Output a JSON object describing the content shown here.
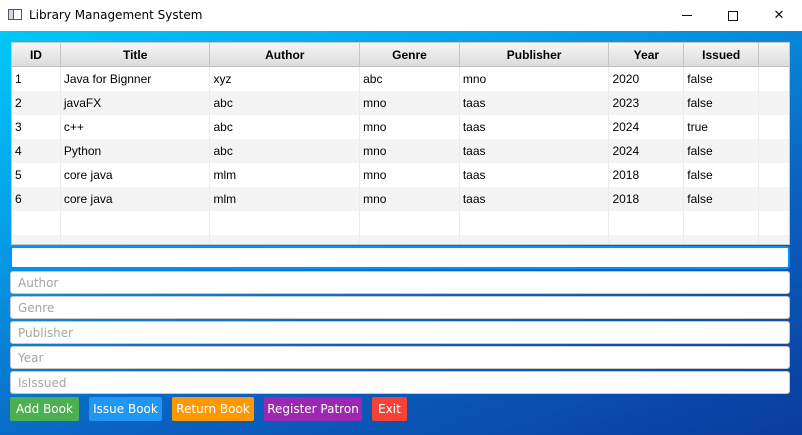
{
  "window": {
    "title": "Library Management System"
  },
  "table": {
    "columns": [
      "ID",
      "Title",
      "Author",
      "Genre",
      "Publisher",
      "Year",
      "Issued"
    ],
    "rows": [
      [
        "1",
        "Java for Bignner",
        "xyz",
        "abc",
        "mno",
        "2020",
        "false"
      ],
      [
        "2",
        "javaFX",
        "abc",
        "mno",
        "taas",
        "2023",
        "false"
      ],
      [
        "3",
        "c++",
        "abc",
        "mno",
        "taas",
        "2024",
        "true"
      ],
      [
        "4",
        "Python",
        "abc",
        "mno",
        "taas",
        "2024",
        "false"
      ],
      [
        "5",
        "core java",
        "mlm",
        "mno",
        "taas",
        "2018",
        "false"
      ],
      [
        "6",
        "core java",
        "mlm",
        "mno",
        "taas",
        "2018",
        "false"
      ]
    ]
  },
  "form": {
    "title_placeholder": "",
    "author_placeholder": "Author",
    "genre_placeholder": "Genre",
    "publisher_placeholder": "Publisher",
    "year_placeholder": "Year",
    "issued_placeholder": "IsIssued"
  },
  "buttons": {
    "add": "Add Book",
    "issue": "Issue Book",
    "return": "Return Book",
    "register": "Register Patron",
    "exit": "Exit"
  },
  "colors": {
    "add": "#4caf50",
    "issue": "#2196f3",
    "return": "#ff9800",
    "register": "#9c27b0",
    "exit": "#f44336",
    "focus": "#0093ff"
  }
}
